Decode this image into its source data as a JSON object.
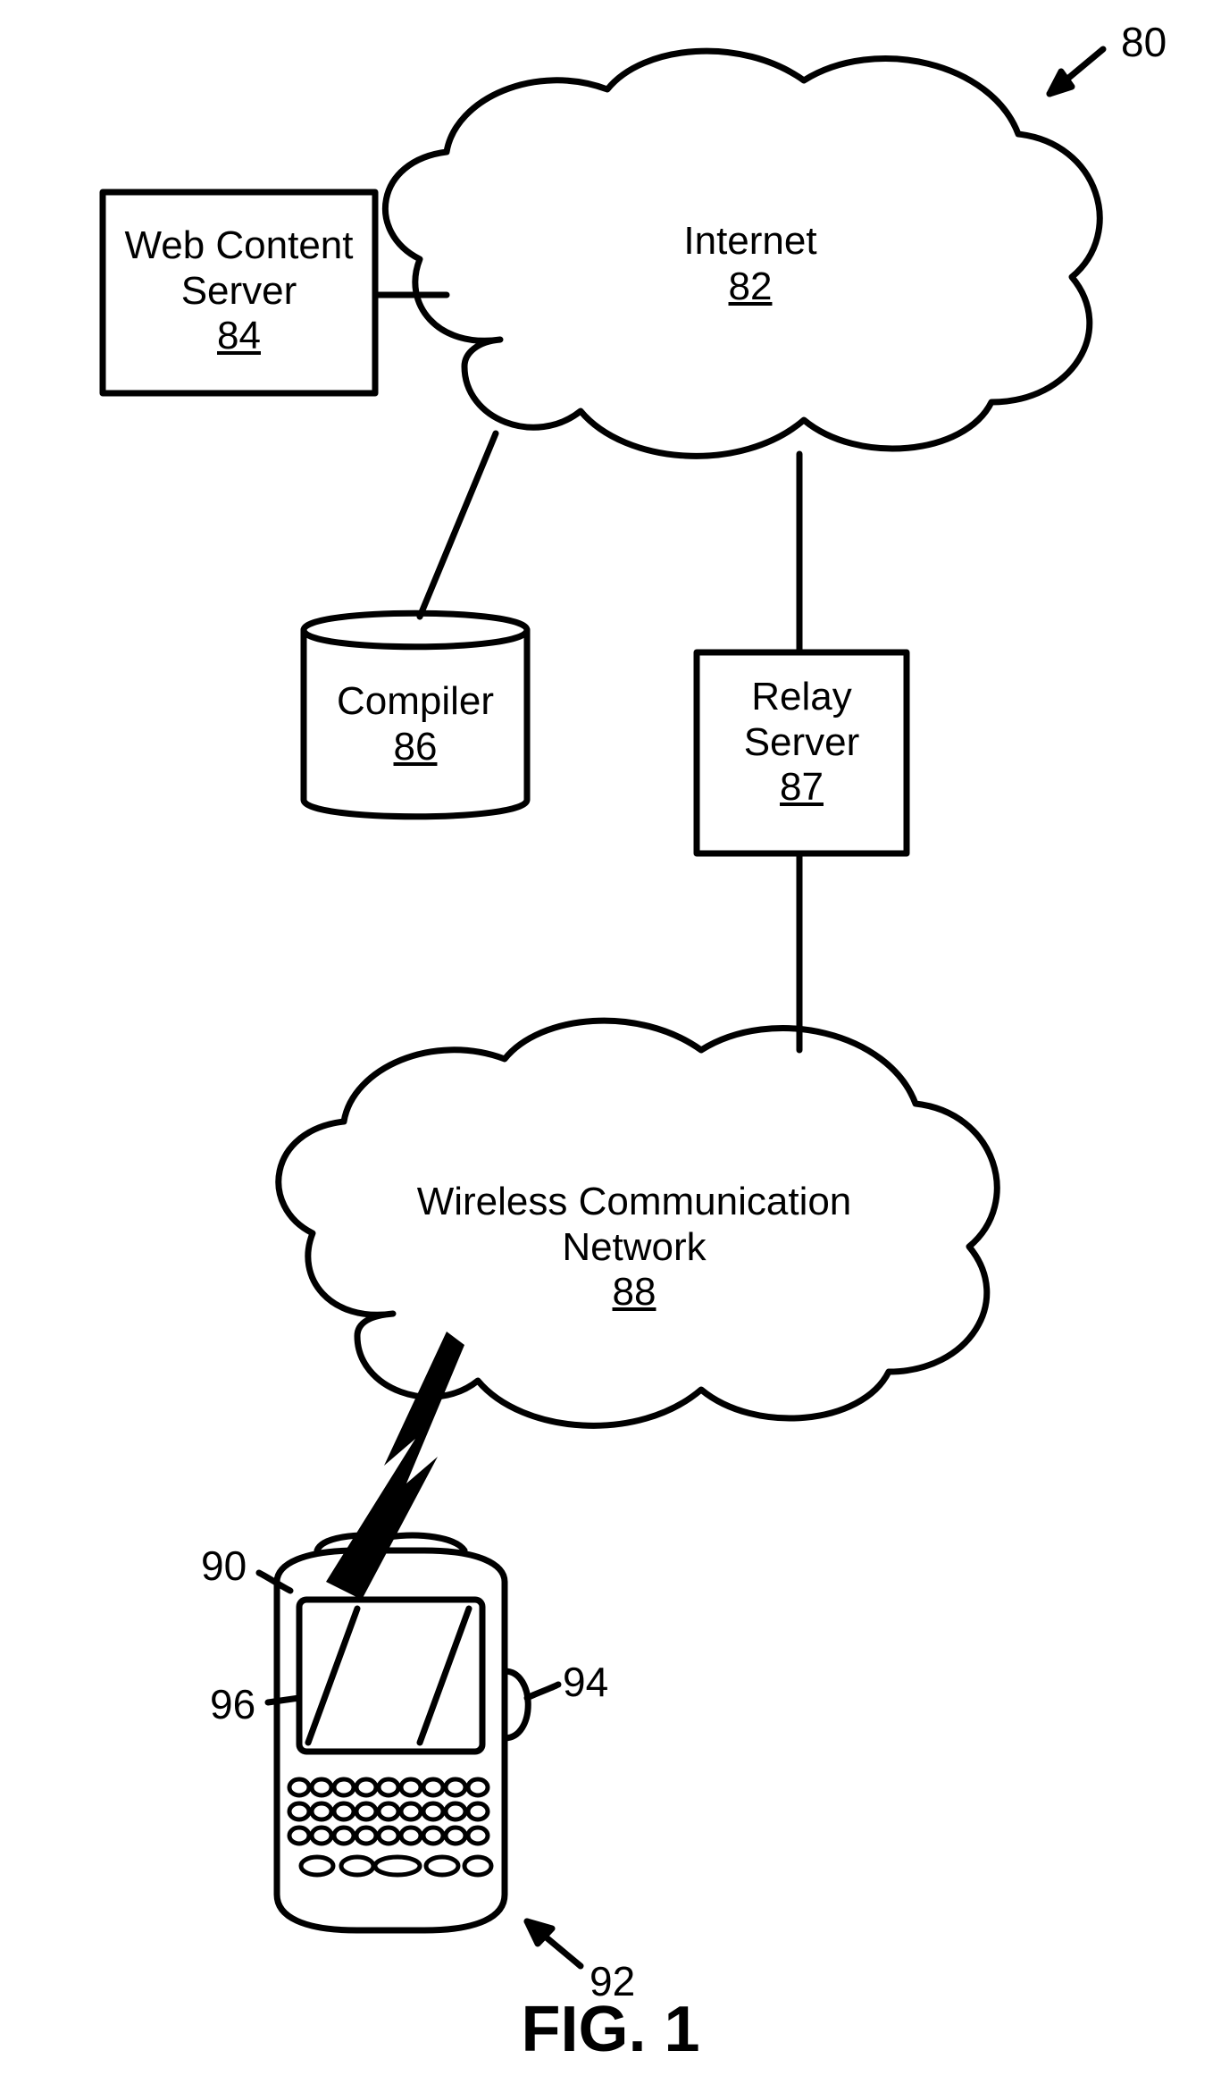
{
  "figure_caption": "FIG. 1",
  "system_ref": "80",
  "nodes": {
    "web_content_server": {
      "title": "Web Content\nServer",
      "num": "84"
    },
    "internet": {
      "title": "Internet",
      "num": "82"
    },
    "compiler": {
      "title": "Compiler",
      "num": "86"
    },
    "relay_server": {
      "title": "Relay\nServer",
      "num": "87"
    },
    "wireless_net": {
      "title": "Wireless Communication\nNetwork",
      "num": "88"
    }
  },
  "device_refs": {
    "top": "90",
    "right": "94",
    "left": "96",
    "bottom": "92"
  }
}
